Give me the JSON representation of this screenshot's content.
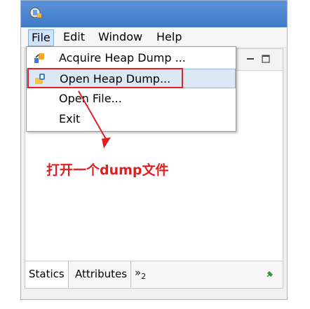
{
  "menubar": {
    "items": [
      {
        "label": "File"
      },
      {
        "label": "Edit"
      },
      {
        "label": "Window"
      },
      {
        "label": "Help"
      }
    ]
  },
  "file_menu": {
    "items": [
      {
        "label": "Acquire Heap Dump ...",
        "icon": "acquire-heap-icon"
      },
      {
        "label": "Open Heap Dump...",
        "icon": "open-heap-icon"
      },
      {
        "label": "Open File..."
      },
      {
        "label": "Exit"
      }
    ]
  },
  "annotation": {
    "text": "打开一个dump文件"
  },
  "bottom_tabs": {
    "items": [
      {
        "label": "Statics"
      },
      {
        "label": "Attributes"
      }
    ],
    "overflow_label": "»",
    "overflow_count": "2"
  },
  "colors": {
    "accent": "#e02020",
    "titlebar": "#4a86d0",
    "menu_highlight": "#dce8f6"
  }
}
